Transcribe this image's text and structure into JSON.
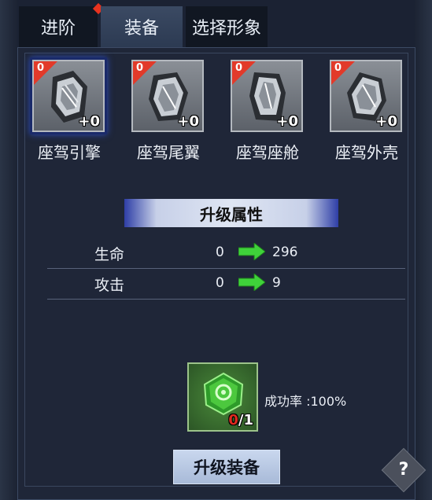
{
  "tabs": [
    {
      "label": "进阶",
      "has_notice": true
    },
    {
      "label": "装备",
      "active": true
    },
    {
      "label": "选择形象"
    }
  ],
  "slots": [
    {
      "name": "座驾引擎",
      "level": "0",
      "plus": "+0",
      "selected": true,
      "icon": "engine-icon"
    },
    {
      "name": "座驾尾翼",
      "level": "0",
      "plus": "+0",
      "icon": "tail-wing-icon"
    },
    {
      "name": "座驾座舱",
      "level": "0",
      "plus": "+0",
      "icon": "cockpit-icon"
    },
    {
      "name": "座驾外壳",
      "level": "0",
      "plus": "+0",
      "icon": "shell-icon"
    }
  ],
  "attributes": {
    "title": "升级属性",
    "rows": [
      {
        "label": "生命",
        "from": "0",
        "to": "296"
      },
      {
        "label": "攻击",
        "from": "0",
        "to": "9"
      }
    ]
  },
  "material": {
    "icon": "green-gem-icon",
    "have": "0",
    "need": "/1"
  },
  "success_rate": "成功率 :100%",
  "upgrade_button": "升级装备",
  "help_label": "?",
  "colors": {
    "accent_green": "#3fd23a",
    "notice_red": "#e8331f",
    "highlight_blue": "#2c4bb8"
  }
}
